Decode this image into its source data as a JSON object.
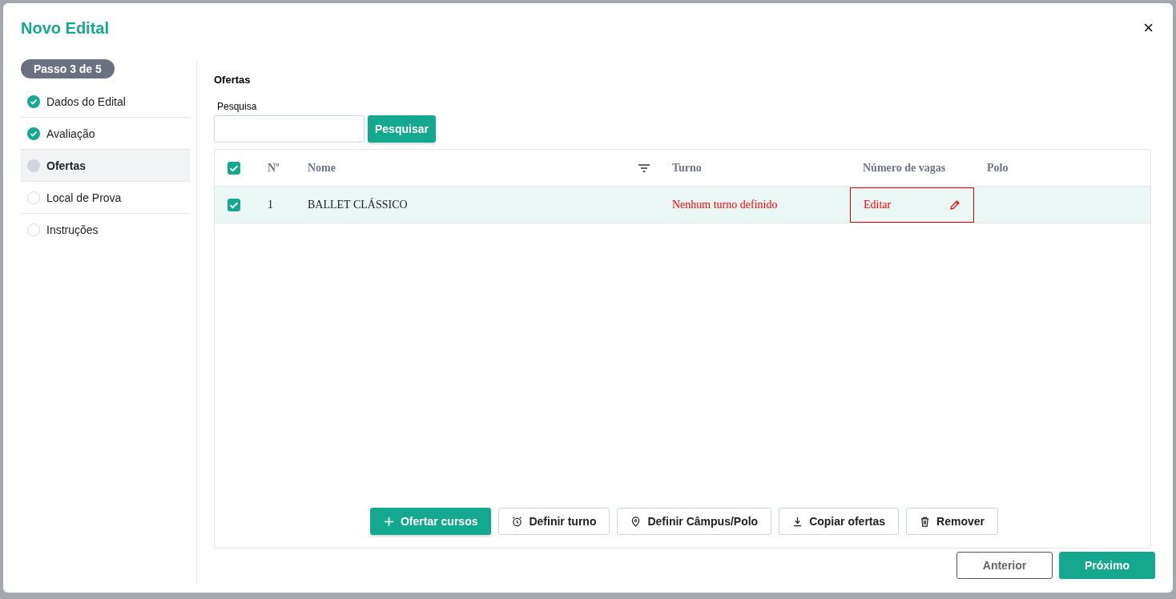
{
  "dialog": {
    "title": "Novo Edital",
    "close": "×"
  },
  "stepper": {
    "badge": "Passo 3 de 5",
    "steps": [
      {
        "label": "Dados do Edital",
        "kind": "done",
        "selected": false
      },
      {
        "label": "Avaliação",
        "kind": "done",
        "selected": false
      },
      {
        "label": "Ofertas",
        "kind": "current",
        "selected": true
      },
      {
        "label": "Local de Prova",
        "kind": "todo",
        "selected": false
      },
      {
        "label": "Instruções",
        "kind": "todo",
        "selected": false
      }
    ]
  },
  "section_title": "Ofertas",
  "search": {
    "label": "Pesquisa",
    "button": "Pesquisar"
  },
  "table": {
    "all_checked": true,
    "columns": [
      {
        "label": "Nº"
      },
      {
        "label": "Nome",
        "filter": true
      },
      {
        "label": "Turno"
      },
      {
        "label": "Número de vagas"
      },
      {
        "label": "Polo"
      }
    ],
    "rows": [
      {
        "checked": true,
        "number": "1",
        "nome": "BALLET CLÁSSICO",
        "turno": "Nenhum turno definido",
        "turno_missing": true,
        "vagas": "Editar",
        "vagas_error": true
      }
    ]
  },
  "actions": [
    {
      "label": "Ofertar cursos",
      "kind": "add"
    },
    {
      "label": "Definir turno",
      "kind": "shift"
    },
    {
      "label": "Definir Câmpus/Polo",
      "kind": "place"
    },
    {
      "label": "Copiar ofertas",
      "kind": "copy"
    },
    {
      "label": "Remover",
      "kind": "remove"
    }
  ],
  "footer": {
    "previous": "Anterior",
    "next": "Próximo"
  }
}
